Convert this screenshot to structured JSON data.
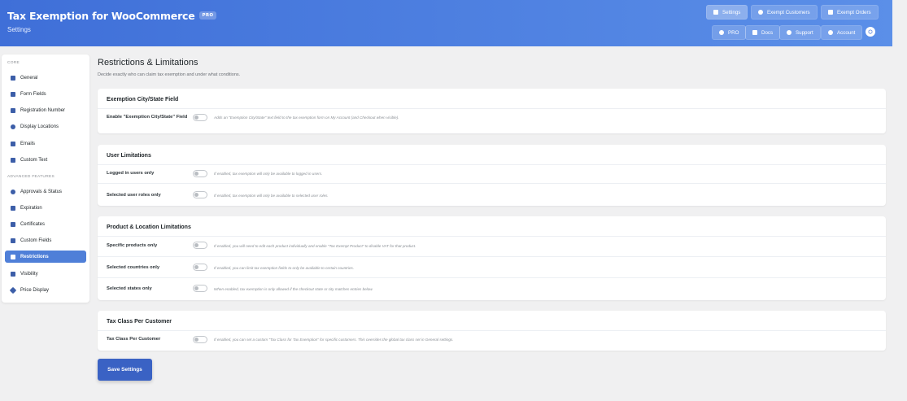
{
  "header": {
    "title": "Tax Exemption for WooCommerce",
    "pro_badge": "PRO",
    "subtitle": "Settings",
    "top_buttons": [
      {
        "label": "Settings",
        "icon": "settings-icon",
        "active": true
      },
      {
        "label": "Exempt Customers",
        "icon": "customers-icon"
      },
      {
        "label": "Exempt Orders",
        "icon": "cart-icon"
      }
    ],
    "sub_buttons": [
      {
        "label": "PRO",
        "icon": "pro-icon"
      },
      {
        "label": "Docs",
        "icon": "docs-icon"
      },
      {
        "label": "Support",
        "icon": "support-icon"
      },
      {
        "label": "Account",
        "icon": "account-icon"
      }
    ],
    "avatar_label": "⬡"
  },
  "sidebar": {
    "core_label": "CORE",
    "advanced_label": "ADVANCED FEATURES",
    "items": [
      {
        "label": "General",
        "icon": "general-icon"
      },
      {
        "label": "Form Fields",
        "icon": "form-fields-icon"
      },
      {
        "label": "Registration Number",
        "icon": "registration-icon"
      },
      {
        "label": "Display Locations",
        "icon": "eye-icon"
      },
      {
        "label": "Emails",
        "icon": "email-icon"
      },
      {
        "label": "Custom Text",
        "icon": "text-icon"
      },
      {
        "label": "Approvals & Status",
        "icon": "check-icon"
      },
      {
        "label": "Expiration",
        "icon": "calendar-icon"
      },
      {
        "label": "Certificates",
        "icon": "certificate-icon"
      },
      {
        "label": "Custom Fields",
        "icon": "grid-icon"
      },
      {
        "label": "Restrictions",
        "icon": "lock-icon",
        "active": true
      },
      {
        "label": "Visibility",
        "icon": "visibility-icon"
      },
      {
        "label": "Price Display",
        "icon": "tag-icon"
      }
    ]
  },
  "main": {
    "title": "Restrictions & Limitations",
    "description": "Decide exactly who can claim tax exemption and under what conditions.",
    "cards": [
      {
        "title": "Exemption City/State Field",
        "rows": [
          {
            "label": "Enable \"Exemption City/State\" Field",
            "desc": "Adds an \"Exemption City/State\" text field to the tax exemption form on My Account (and Checkout when visible).",
            "enabled": false
          }
        ]
      },
      {
        "title": "User Limitations",
        "rows": [
          {
            "label": "Logged in users only",
            "desc": "If enabled, tax exemption will only be available to logged in users.",
            "enabled": false
          },
          {
            "label": "Selected user roles only",
            "desc": "If enabled, tax exemption will only be available to selected user roles.",
            "enabled": false
          }
        ]
      },
      {
        "title": "Product & Location Limitations",
        "rows": [
          {
            "label": "Specific products only",
            "desc": "If enabled, you will need to edit each product individually and enable \"Tax Exempt Product\" to disable VAT for that product.",
            "enabled": false
          },
          {
            "label": "Selected countries only",
            "desc": "If enabled, you can limit tax exemption fields to only be available to certain countries.",
            "enabled": false
          },
          {
            "label": "Selected states only",
            "desc": "When enabled, tax exemption is only allowed if the checkout state or city matches entries below.",
            "enabled": false
          }
        ]
      },
      {
        "title": "Tax Class Per Customer",
        "rows": [
          {
            "label": "Tax Class Per Customer",
            "desc": "If enabled, you can set a custom \"Tax Class for Tax Exemption\" for specific customers. This overrides the global tax class set in General settings.",
            "enabled": false
          }
        ]
      }
    ],
    "save_label": "Save Settings"
  },
  "colors": {
    "header_start": "#3f6fd8",
    "header_end": "#5b8fe8",
    "accent": "#4f7fd8",
    "save_button": "#3a62c4"
  }
}
